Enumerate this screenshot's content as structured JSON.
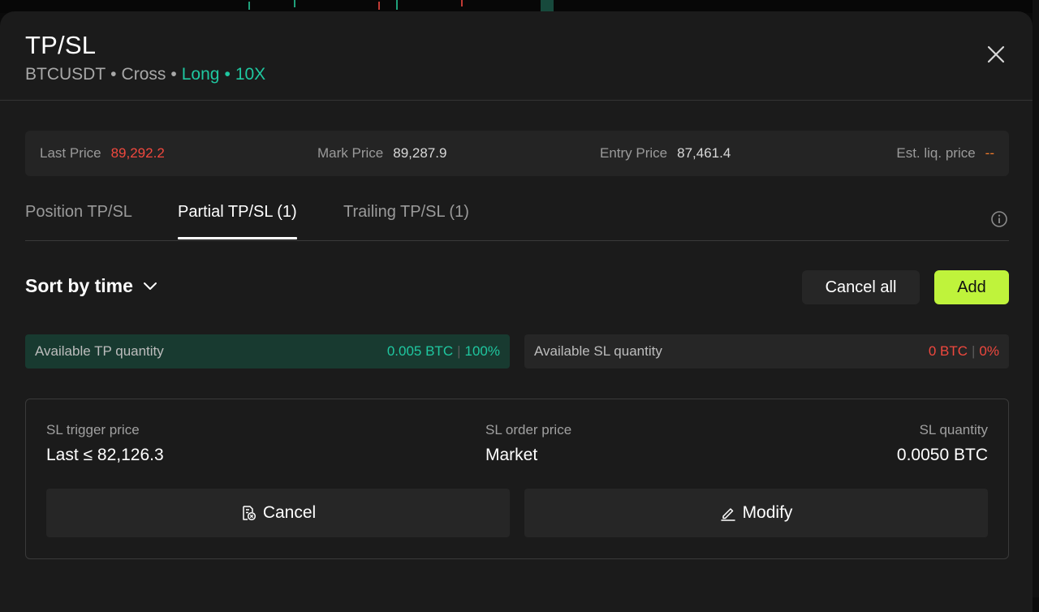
{
  "header": {
    "title": "TP/SL",
    "symbol": "BTCUSDT",
    "margin_mode": "Cross",
    "side": "Long",
    "leverage": "10X",
    "separator": "•"
  },
  "prices": {
    "last_price_label": "Last Price",
    "last_price": "89,292.2",
    "mark_price_label": "Mark Price",
    "mark_price": "89,287.9",
    "entry_price_label": "Entry Price",
    "entry_price": "87,461.4",
    "liq_price_label": "Est. liq. price",
    "liq_price": "--"
  },
  "tabs": [
    {
      "label": "Position TP/SL",
      "active": false
    },
    {
      "label": "Partial TP/SL (1)",
      "active": true
    },
    {
      "label": "Trailing TP/SL (1)",
      "active": false
    }
  ],
  "toolbar": {
    "sort_label": "Sort by time",
    "cancel_all_label": "Cancel all",
    "add_label": "Add"
  },
  "quantities": {
    "tp_label": "Available TP quantity",
    "tp_amount": "0.005 BTC",
    "tp_percent": "100%",
    "sl_label": "Available SL quantity",
    "sl_amount": "0 BTC",
    "sl_percent": "0%",
    "divider": "|"
  },
  "order": {
    "trigger_label": "SL trigger price",
    "trigger_value": "Last ≤ 82,126.3",
    "order_price_label": "SL order price",
    "order_price_value": "Market",
    "quantity_label": "SL quantity",
    "quantity_value": "0.0050 BTC",
    "cancel_label": "Cancel",
    "modify_label": "Modify"
  },
  "colors": {
    "accent_green": "#1fc7a0",
    "loss_red": "#f0483e",
    "add_button": "#bff33b",
    "warning_orange": "#f07a2a"
  },
  "icons": [
    "close-icon",
    "info-icon",
    "chevron-down-icon",
    "cancel-order-icon",
    "edit-icon"
  ]
}
